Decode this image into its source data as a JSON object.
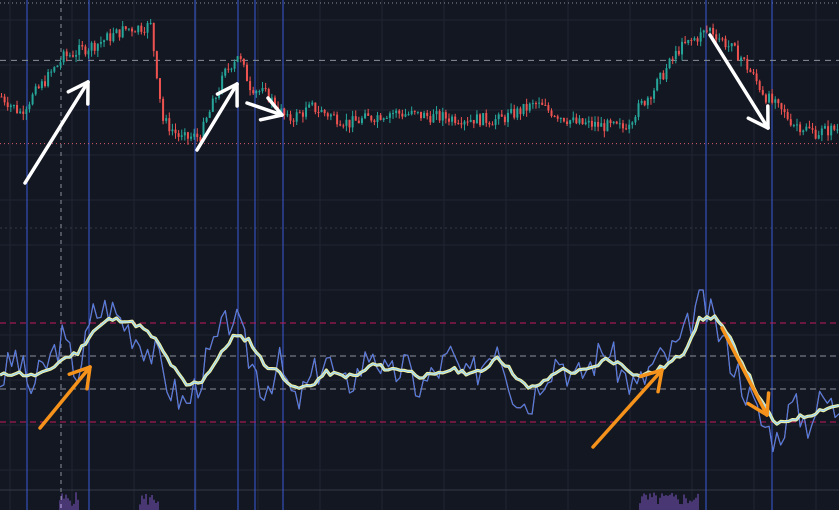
{
  "colors": {
    "background": "#131722",
    "grid": "#1f2433",
    "pane_divider": "#363a45",
    "candle_up": "#26a69a",
    "candle_down": "#ef5350",
    "vertical_marker": "#3a5bd6",
    "level_line": "#8a8f9c",
    "low_line": "#e05a6a",
    "osc_fast": "#4f7de0",
    "osc_fast_alt": "#e05a4a",
    "osc_slow_outer": "#f3f3a0",
    "osc_slow_inner": "#9ad4ff",
    "osc_band": "#c2185b",
    "osc_mid": "#8a8f9c",
    "arrow_price": "#ffffff",
    "arrow_osc": "#f5921b",
    "volume": "#7e57c2"
  },
  "chart_data": [
    {
      "type": "candlestick",
      "pane": "price",
      "title": "",
      "xlabel": "",
      "ylabel": "",
      "grid": true,
      "n_bars": 270,
      "approx_close_path": [
        [
          0,
          55
        ],
        [
          6,
          45
        ],
        [
          20,
          80
        ],
        [
          30,
          88
        ],
        [
          40,
          98
        ],
        [
          48,
          100
        ],
        [
          52,
          40
        ],
        [
          58,
          28
        ],
        [
          64,
          30
        ],
        [
          72,
          70
        ],
        [
          76,
          82
        ],
        [
          80,
          62
        ],
        [
          86,
          55
        ],
        [
          92,
          40
        ],
        [
          100,
          48
        ],
        [
          112,
          38
        ],
        [
          125,
          45
        ],
        [
          140,
          42
        ],
        [
          160,
          40
        ],
        [
          172,
          50
        ],
        [
          185,
          38
        ],
        [
          200,
          35
        ],
        [
          210,
          60
        ],
        [
          218,
          85
        ],
        [
          228,
          98
        ],
        [
          238,
          80
        ],
        [
          246,
          55
        ],
        [
          255,
          38
        ],
        [
          262,
          32
        ],
        [
          270,
          35
        ]
      ],
      "horizontal_levels": [
        {
          "name": "upper",
          "value": 78,
          "style": "dashed"
        },
        {
          "name": "lower",
          "value": 25,
          "style": "dotted"
        }
      ]
    },
    {
      "type": "line",
      "pane": "oscillator",
      "title": "",
      "grid": true,
      "ylim": [
        0,
        100
      ],
      "series": [
        {
          "role": "fast",
          "values_sampled": [
            45,
            60,
            40,
            55,
            70,
            50,
            85,
            90,
            80,
            70,
            60,
            40,
            30,
            50,
            70,
            85,
            60,
            40,
            55,
            30,
            45,
            60,
            40,
            50,
            65,
            45,
            55,
            40,
            50,
            60,
            45,
            55,
            70,
            40,
            30,
            50,
            60,
            45,
            55,
            65,
            50,
            40,
            55,
            60,
            70,
            95,
            80,
            60,
            40,
            20,
            10,
            30,
            20,
            35,
            25
          ]
        },
        {
          "role": "slow",
          "values_sampled": [
            48,
            50,
            48,
            50,
            58,
            62,
            75,
            82,
            82,
            78,
            70,
            55,
            42,
            45,
            58,
            72,
            70,
            55,
            50,
            40,
            42,
            50,
            48,
            48,
            55,
            52,
            52,
            48,
            48,
            52,
            50,
            50,
            60,
            50,
            40,
            44,
            52,
            50,
            52,
            58,
            55,
            48,
            50,
            55,
            62,
            82,
            84,
            70,
            52,
            32,
            18,
            22,
            24,
            28,
            30
          ]
        }
      ],
      "horizontal_levels": [
        {
          "name": "overbought",
          "value": 80,
          "style": "dashed"
        },
        {
          "name": "mid_upper",
          "value": 60,
          "style": "dashed"
        },
        {
          "name": "mid_lower",
          "value": 40,
          "style": "dashed"
        },
        {
          "name": "oversold",
          "value": 20,
          "style": "dashed"
        }
      ]
    }
  ],
  "annotations": [
    {
      "pane": "price",
      "direction": "up",
      "color_role": "arrow_price"
    },
    {
      "pane": "price",
      "direction": "up",
      "color_role": "arrow_price"
    },
    {
      "pane": "price",
      "direction": "up",
      "color_role": "arrow_price"
    },
    {
      "pane": "price",
      "direction": "down",
      "color_role": "arrow_price"
    },
    {
      "pane": "oscillator",
      "direction": "up",
      "color_role": "arrow_osc"
    },
    {
      "pane": "oscillator",
      "direction": "up",
      "color_role": "arrow_osc"
    },
    {
      "pane": "oscillator",
      "direction": "down",
      "color_role": "arrow_osc"
    }
  ]
}
